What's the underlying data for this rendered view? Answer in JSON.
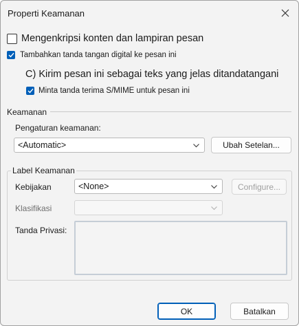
{
  "window": {
    "title": "Properti Keamanan"
  },
  "options": {
    "encrypt": {
      "label": "Mengenkripsi konten dan lampiran pesan",
      "checked": false
    },
    "sign": {
      "label": "Tambahkan tanda tangan digital ke pesan ini",
      "checked": true
    },
    "clear_text": {
      "label": "C) Kirim pesan ini sebagai teks yang jelas ditandatangani"
    },
    "receipt": {
      "label": "Minta tanda terima S/MIME untuk pesan ini",
      "checked": true
    }
  },
  "security": {
    "section_label": "Keamanan",
    "settings_label": "Pengaturan keamanan:",
    "settings_value": "<Automatic>",
    "change_button": "Ubah Setelan..."
  },
  "security_label": {
    "group_label": "Label Keamanan",
    "policy_label": "Kebijakan",
    "policy_value": "<None>",
    "configure_button": "Configure...",
    "classification_label": "Klasifikasi",
    "classification_value": "",
    "privacy_label": "Tanda Privasi:"
  },
  "footer": {
    "ok_button": "OK",
    "cancel_button": "Batalkan"
  },
  "colors": {
    "accent": "#005fb8",
    "background": "#f3f3f3"
  },
  "icons": {
    "close": "close-icon",
    "check": "check-icon",
    "dropdown": "chevron-down-icon"
  }
}
